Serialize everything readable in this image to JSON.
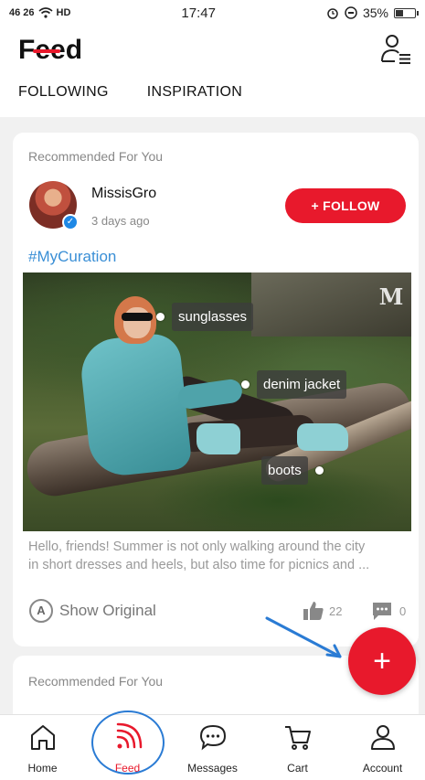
{
  "status_bar": {
    "signal": "46 26",
    "network": "HD",
    "time": "17:47",
    "battery": "35%",
    "battery_level": 0.35
  },
  "header": {
    "title": "Feed",
    "tabs": [
      {
        "label": "FOLLOWING",
        "active": true
      },
      {
        "label": "INSPIRATION",
        "active": false
      }
    ]
  },
  "post": {
    "section_label": "Recommended For You",
    "username": "MissisGro",
    "time_ago": "3 days ago",
    "follow_label": "+ FOLLOW",
    "hashtag": "#MyCuration",
    "tags": [
      "sunglasses",
      "denim jacket",
      "boots"
    ],
    "brand_mark": "M",
    "text_line1": "Hello, friends! Summer is not only walking around the city",
    "text_line2": "in short dresses and heels, but also time for picnics and ...",
    "translate_badge": "A",
    "show_original_label": "Show Original",
    "likes": "22",
    "comments": "0"
  },
  "next_post": {
    "section_label": "Recommended For You"
  },
  "fab": {
    "label": "+"
  },
  "nav": {
    "items": [
      {
        "label": "Home"
      },
      {
        "label": "Feed"
      },
      {
        "label": "Messages"
      },
      {
        "label": "Cart"
      },
      {
        "label": "Account"
      }
    ]
  },
  "colors": {
    "accent": "#e8192c",
    "link": "#3a8fd6",
    "annotation": "#2a7bd4"
  }
}
